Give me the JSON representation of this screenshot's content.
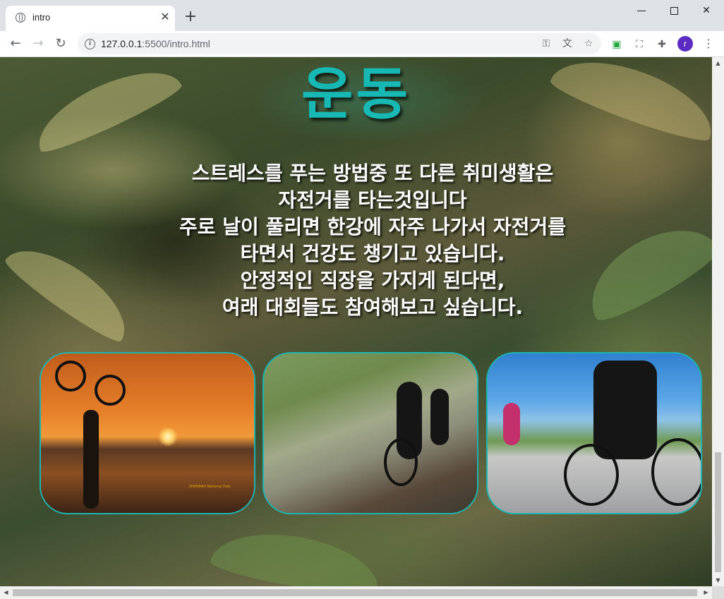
{
  "browser": {
    "tab_title": "intro",
    "new_tab_label": "+",
    "url_host": "127.0.0.1",
    "url_rest": ":5500/intro.html",
    "profile_initial": "r",
    "accent_color": "#5b2bc4"
  },
  "page": {
    "heading": "운동",
    "heading_color": "#18b8b4",
    "intro_lines": [
      "스트레스를 푸는 방법중 또 다른 취미생활은",
      "자전거를 타는것입니다",
      "주로 날이 풀리면 한강에 자주 나가서 자전거를",
      "타면서 건강도 챙기고 있습니다.",
      "안정적인 직장을 가지게 된다면,",
      "여래 대회들도 참여해보고 싶습니다."
    ],
    "photos": [
      {
        "name": "sunset-bike-photo",
        "caption": "SHIHWAH National Park"
      },
      {
        "name": "road-cyclists-photo"
      },
      {
        "name": "mountain-cyclists-photo"
      }
    ]
  }
}
